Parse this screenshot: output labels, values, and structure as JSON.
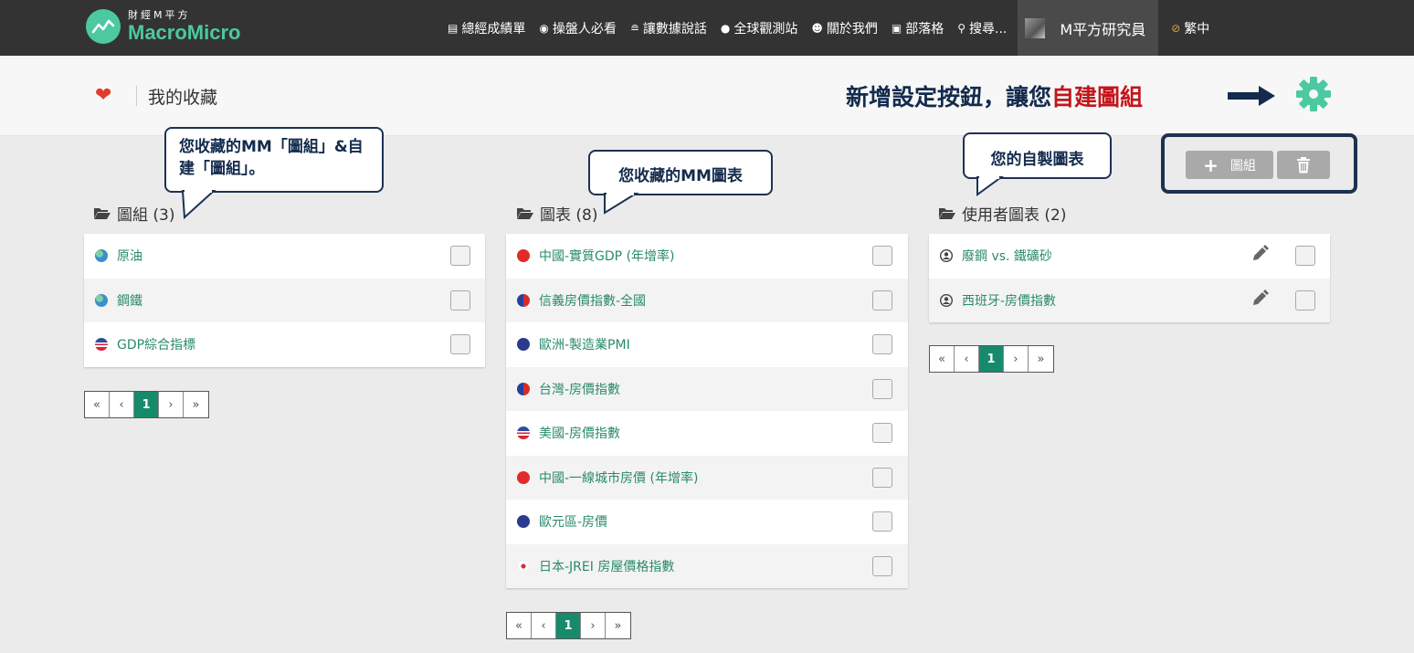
{
  "navbar": {
    "logo_cn": "財經M平方",
    "logo_en": "MacroMicro",
    "items": [
      {
        "label": "總經成績單",
        "icon": "document-icon"
      },
      {
        "label": "操盤人必看",
        "icon": "eye-icon"
      },
      {
        "label": "讓數據說話",
        "icon": "database-icon"
      },
      {
        "label": "全球觀測站",
        "icon": "globe-icon"
      },
      {
        "label": "關於我們",
        "icon": "users-icon"
      },
      {
        "label": "部落格",
        "icon": "blog-icon"
      },
      {
        "label": "搜尋...",
        "icon": "search-icon"
      }
    ],
    "user_name": "M平方研究員",
    "language": "繁中"
  },
  "header": {
    "title": "我的收藏",
    "promo_text": "新增設定按鈕，讓您",
    "promo_highlight": "自建圖組"
  },
  "callouts": {
    "collections": "您收藏的MM「圖組」&自建「圖組」。",
    "charts": "您收藏的MM圖表",
    "user_charts": "您的自製圖表"
  },
  "toolbar": {
    "add_label": "圖組"
  },
  "sections": {
    "collections": {
      "title": "圖組 (3)",
      "items": [
        {
          "label": "原油",
          "flag": "globe"
        },
        {
          "label": "鋼鐵",
          "flag": "globe"
        },
        {
          "label": "GDP綜合指標",
          "flag": "us"
        }
      ]
    },
    "charts": {
      "title": "圖表 (8)",
      "items": [
        {
          "label": "中國-實質GDP (年增率)",
          "flag": "cn"
        },
        {
          "label": "信義房價指數-全國",
          "flag": "tw"
        },
        {
          "label": "歐洲-製造業PMI",
          "flag": "eu"
        },
        {
          "label": "台灣-房價指數",
          "flag": "tw"
        },
        {
          "label": "美國-房價指數",
          "flag": "us"
        },
        {
          "label": "中國-一線城市房價 (年增率)",
          "flag": "cn"
        },
        {
          "label": "歐元區-房價",
          "flag": "eu"
        },
        {
          "label": "日本-JREI 房屋價格指數",
          "flag": "jp"
        }
      ]
    },
    "user_charts": {
      "title": "使用者圖表 (2)",
      "items": [
        {
          "label": "廢鋼 vs. 鐵礦砂"
        },
        {
          "label": "西班牙-房價指數"
        }
      ]
    }
  },
  "pagination": {
    "first": "«",
    "prev": "‹",
    "current": "1",
    "next": "›",
    "last": "»"
  }
}
